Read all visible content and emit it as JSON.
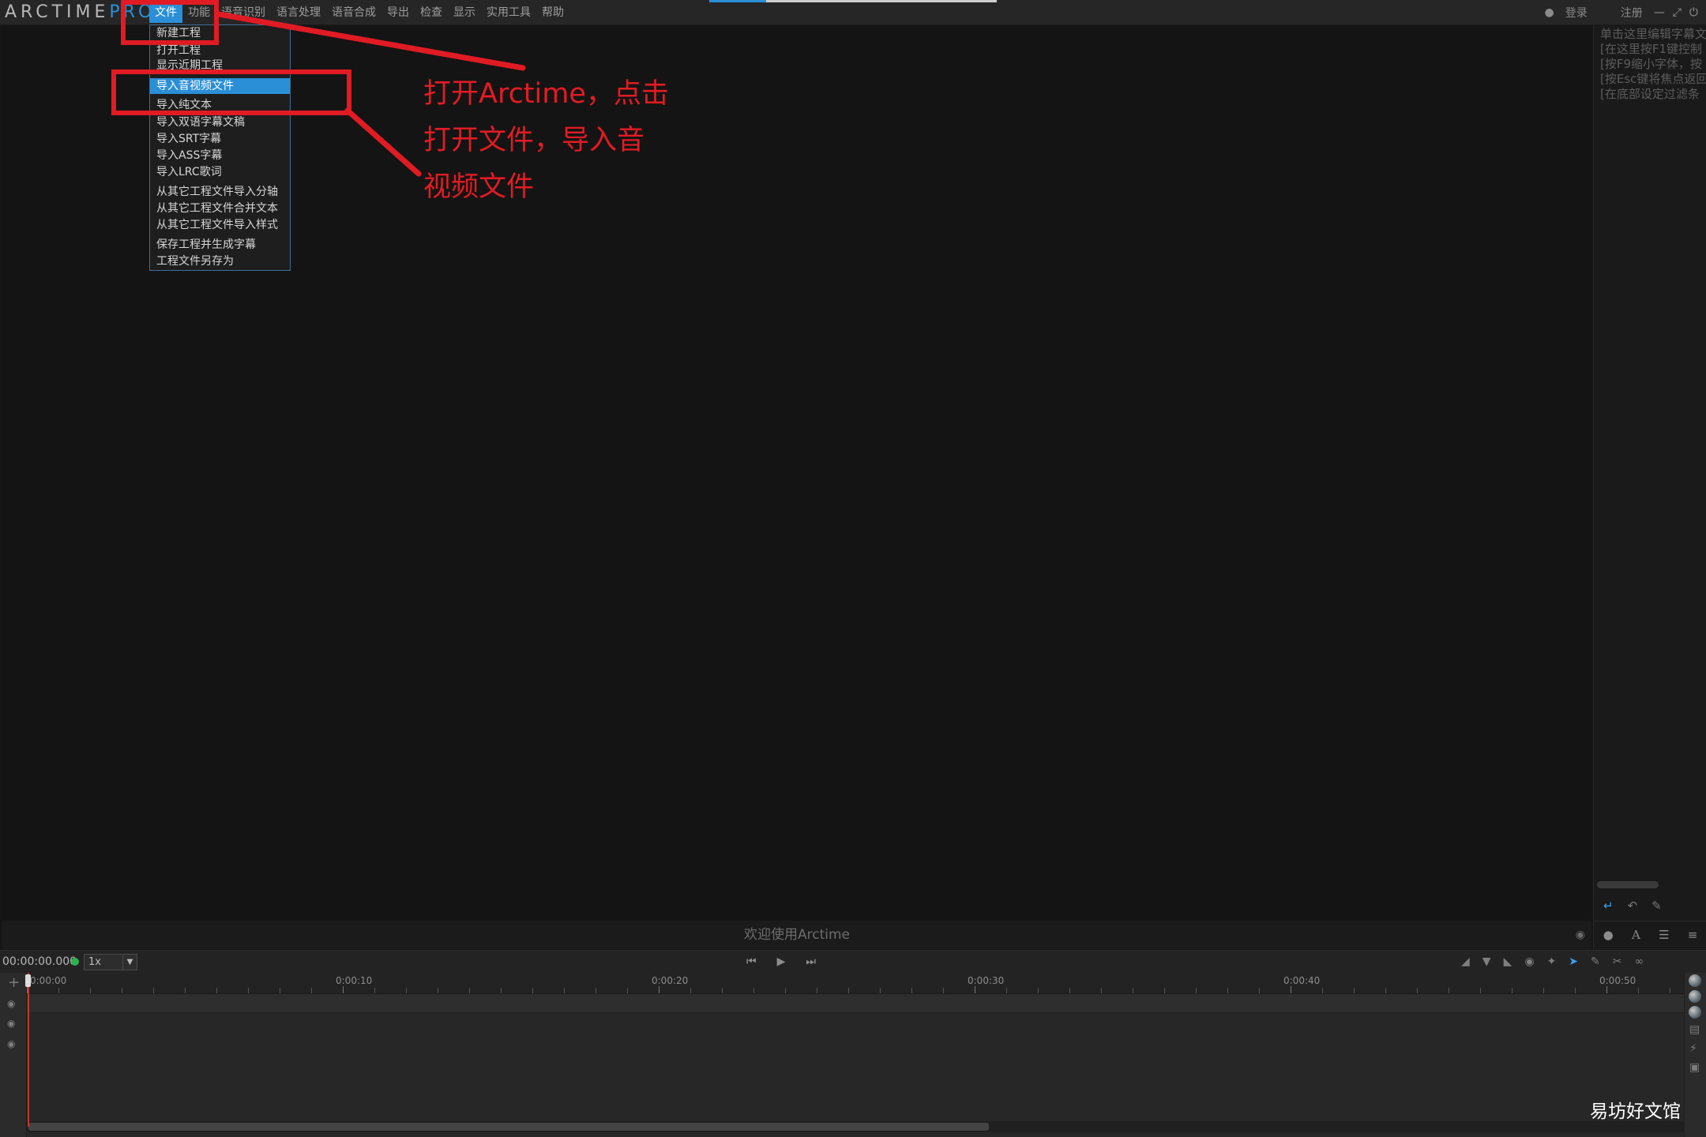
{
  "app": {
    "logo_main": "ARCTIME",
    "logo_pro": "PRO"
  },
  "menubar": [
    "文件",
    "功能",
    "语音识别",
    "语言处理",
    "语音合成",
    "导出",
    "检查",
    "显示",
    "实用工具",
    "帮助"
  ],
  "user": {
    "login": "登录",
    "register": "注册"
  },
  "file_menu": {
    "items": [
      "新建工程",
      "打开工程",
      "显示近期工程",
      "导入音视频文件",
      "导入纯文本",
      "导入双语字幕文稿",
      "导入SRT字幕",
      "导入ASS字幕",
      "导入LRC歌词",
      "从其它工程文件导入分轴",
      "从其它工程文件合并文本",
      "从其它工程文件导入样式",
      "保存工程并生成字幕",
      "工程文件另存为"
    ],
    "highlighted": "导入音视频文件"
  },
  "subtitle_panel": {
    "lines": [
      "单击这里编辑字幕文",
      "[在这里按F1键控制",
      "[按F9缩小字体，按",
      "[按Esc键将焦点返回",
      "[在底部设定过滤条"
    ]
  },
  "welcome": "欢迎使用Arctime",
  "controls": {
    "timecode": "00:00:00.000",
    "speed": "1x"
  },
  "timeline": {
    "ticks": [
      "0:00:00",
      "0:00:10",
      "0:00:20",
      "0:00:30",
      "0:00:40",
      "0:00:50"
    ]
  },
  "annotation": {
    "lines": [
      "打开Arctime，点击",
      "打开文件，导入音",
      "视频文件"
    ]
  },
  "watermark": "易坊好文馆",
  "colors": {
    "accent": "#2a8fd7",
    "annotation": "#e01b24",
    "status_dot": "#2db34a",
    "playhead": "#c0392b"
  },
  "icons": {
    "user": "user-icon",
    "minimize": "minimize-icon",
    "maximize": "maximize-icon",
    "power": "power-icon",
    "prev": "skip-back-icon",
    "play": "play-icon",
    "next": "skip-forward-icon"
  }
}
